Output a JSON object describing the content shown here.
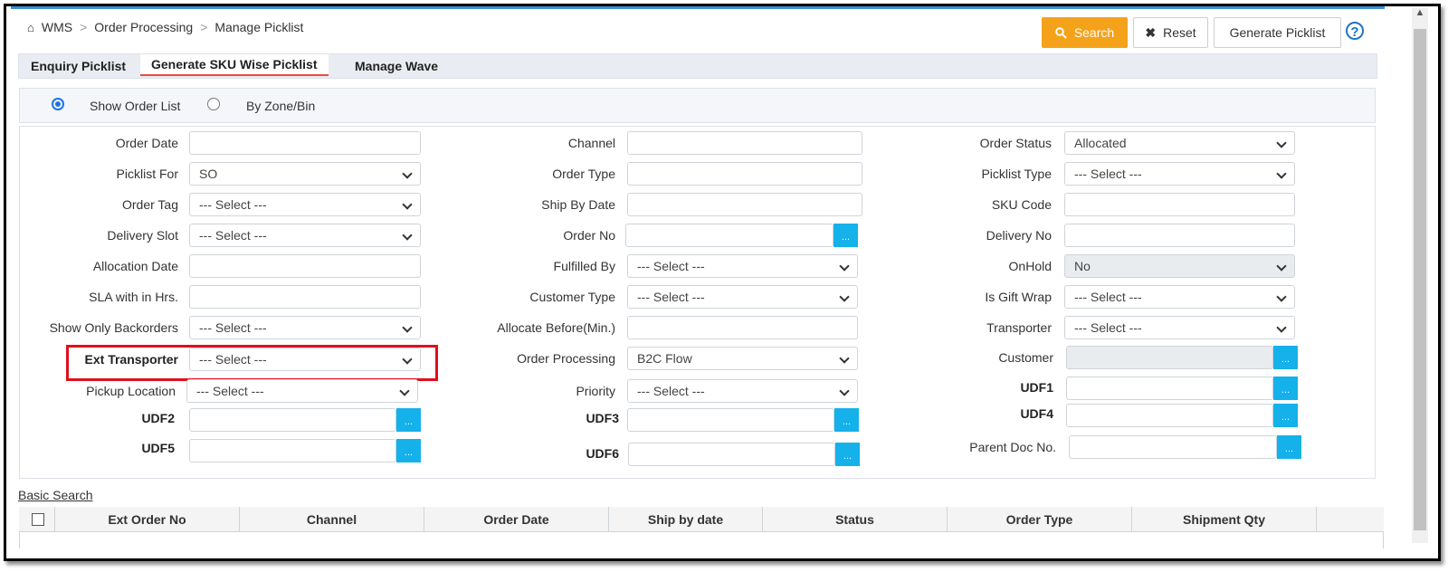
{
  "breadcrumb": {
    "items": [
      "WMS",
      "Order Processing",
      "Manage Picklist"
    ],
    "sep": ">"
  },
  "toolbar": {
    "search_label": "Search",
    "reset_label": "Reset",
    "generate_label": "Generate Picklist",
    "help_glyph": "?"
  },
  "tabs": [
    "Enquiry Picklist",
    "Generate SKU Wise Picklist",
    "Manage Wave"
  ],
  "mode": {
    "options": [
      "Show Order List",
      "By Zone/Bin"
    ],
    "selected": "Show Order List"
  },
  "form": {
    "col1": [
      {
        "label": "Order Date",
        "value": ""
      },
      {
        "label": "Picklist For",
        "value": "SO"
      },
      {
        "label": "Order Tag",
        "value": "--- Select ---"
      },
      {
        "label": "Delivery Slot",
        "value": "--- Select ---"
      },
      {
        "label": "Allocation Date",
        "value": ""
      },
      {
        "label": "SLA with in Hrs.",
        "value": ""
      },
      {
        "label": "Show Only Backorders",
        "value": "--- Select ---"
      },
      {
        "label": "Ext Transporter",
        "value": "--- Select ---"
      },
      {
        "label": "Pickup Location",
        "value": "--- Select ---"
      },
      {
        "label": "UDF2",
        "value": ""
      },
      {
        "label": "UDF5",
        "value": ""
      }
    ],
    "col2": [
      {
        "label": "Channel",
        "value": ""
      },
      {
        "label": "Order Type",
        "value": ""
      },
      {
        "label": "Ship By Date",
        "value": ""
      },
      {
        "label": "Order No",
        "value": ""
      },
      {
        "label": "Fulfilled By",
        "value": "--- Select ---"
      },
      {
        "label": "Customer Type",
        "value": "--- Select ---"
      },
      {
        "label": "Allocate Before(Min.)",
        "value": ""
      },
      {
        "label": "Order Processing",
        "value": "B2C Flow"
      },
      {
        "label": "Priority",
        "value": "--- Select ---"
      },
      {
        "label": "UDF3",
        "value": ""
      },
      {
        "label": "UDF6",
        "value": ""
      }
    ],
    "col3": [
      {
        "label": "Order Status",
        "value": "Allocated"
      },
      {
        "label": "Picklist Type",
        "value": "--- Select ---"
      },
      {
        "label": "SKU Code",
        "value": ""
      },
      {
        "label": "Delivery No",
        "value": ""
      },
      {
        "label": "OnHold",
        "value": "No"
      },
      {
        "label": "Is Gift Wrap",
        "value": "--- Select ---"
      },
      {
        "label": "Transporter",
        "value": "--- Select ---"
      },
      {
        "label": "Customer",
        "value": ""
      },
      {
        "label": "UDF1",
        "value": ""
      },
      {
        "label": "UDF4",
        "value": ""
      },
      {
        "label": "Parent Doc No.",
        "value": ""
      }
    ],
    "lookup_glyph": "..."
  },
  "basic_search_label": "Basic Search",
  "grid": {
    "columns": [
      "Ext Order No",
      "Channel",
      "Order Date",
      "Ship by date",
      "Status",
      "Order Type",
      "Shipment Qty"
    ]
  },
  "colors": {
    "accent": "#f5a21b",
    "lookup": "#14b1ea",
    "highlight": "#e0101d",
    "radio": "#1a73e8",
    "tab_underline": "#e2503b"
  },
  "icons": {
    "home": "home-icon",
    "search": "search-icon",
    "reset": "close-icon",
    "help": "help-icon"
  }
}
